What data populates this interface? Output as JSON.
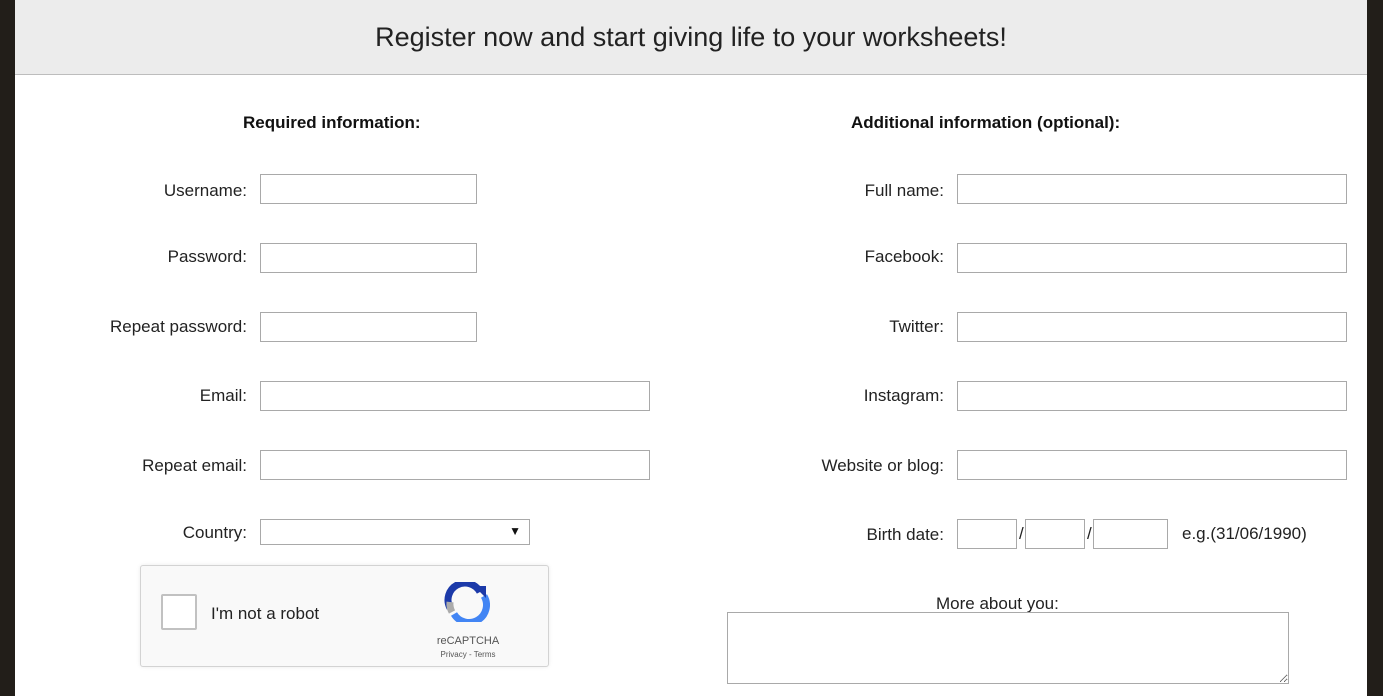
{
  "header": {
    "title": "Register now and start giving life to your worksheets!"
  },
  "required": {
    "title": "Required information:",
    "username_label": "Username:",
    "password_label": "Password:",
    "repeat_password_label": "Repeat password:",
    "email_label": "Email:",
    "repeat_email_label": "Repeat email:",
    "country_label": "Country:",
    "country_value": ""
  },
  "optional": {
    "title": "Additional information (optional):",
    "fullname_label": "Full name:",
    "facebook_label": "Facebook:",
    "twitter_label": "Twitter:",
    "instagram_label": "Instagram:",
    "website_label": "Website or blog:",
    "birthdate_label": "Birth date:",
    "birthdate_hint": "e.g.(31/06/1990)",
    "birthdate_separator": "/",
    "about_label": "More about you:"
  },
  "captcha": {
    "label": "I'm not a robot",
    "brand": "reCAPTCHA",
    "links": "Privacy - Terms"
  },
  "colors": {
    "background": "#221e19",
    "header_bg": "#ececec",
    "accent_arrow": "#e94d9c"
  },
  "icons": {
    "select_arrow": "▼"
  }
}
